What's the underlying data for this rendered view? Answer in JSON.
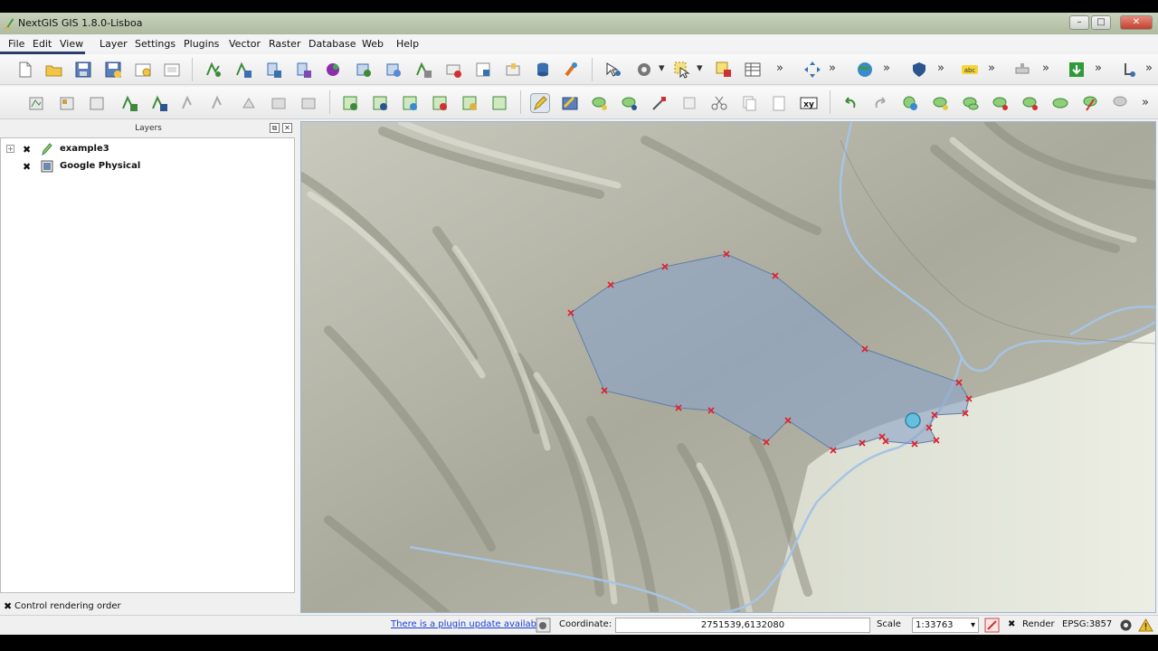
{
  "window": {
    "title": "NextGIS GIS 1.8.0-Lisboa"
  },
  "menubar": {
    "items": [
      "File",
      "Edit",
      "View",
      "Layer",
      "Settings",
      "Plugins",
      "Vector",
      "Raster",
      "Database",
      "Web",
      "Help"
    ]
  },
  "layers_panel": {
    "title": "Layers",
    "layers": [
      {
        "name": "example3",
        "visible": true,
        "icon": "pencil-edit-icon",
        "bold": true
      },
      {
        "name": "Google Physical",
        "visible": true,
        "icon": "raster-layer-icon",
        "bold": true
      }
    ],
    "control_rendering_order": "Control rendering order"
  },
  "statusbar": {
    "plugin_update": "There is a plugin update available",
    "coordinate_label": "Coordinate:",
    "coordinate_value": "2751539,6132080",
    "scale_label": "Scale",
    "scale_value": "1:33763",
    "render_label": "Render",
    "crs": "EPSG:3857"
  },
  "map": {
    "polygon_fill": "#8aa4c8",
    "vertex_color": "#e0202a",
    "river_color": "#a6c4e4"
  }
}
